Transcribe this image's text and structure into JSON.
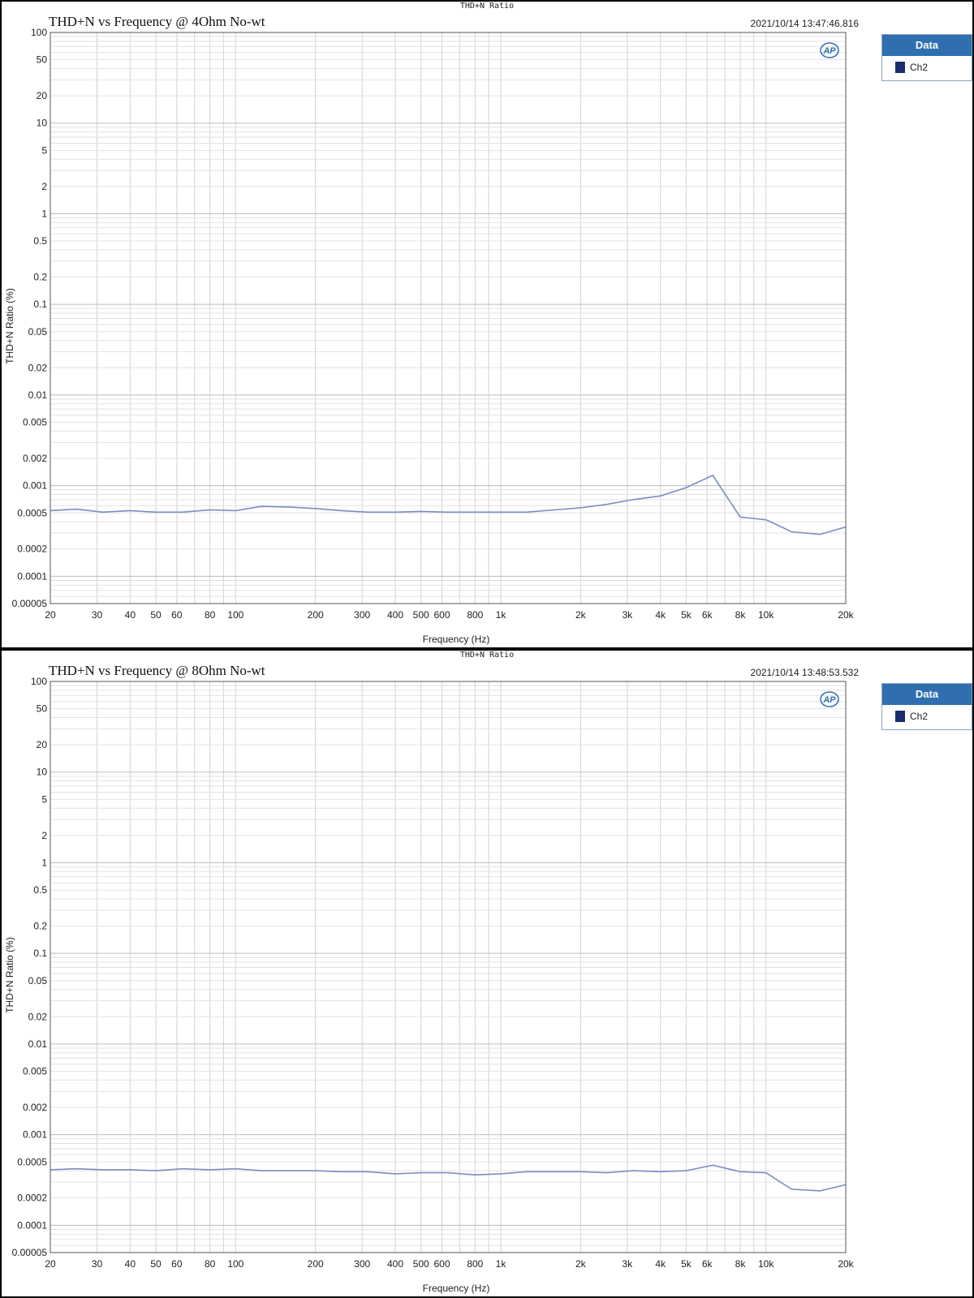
{
  "panels": [
    {
      "window_caption": "THD+N Ratio",
      "title": "THD+N vs Frequency @ 4Ohm No-wt",
      "timestamp": "2021/10/14 13:47:46.816",
      "legend": {
        "header": "Data",
        "entries": [
          "Ch2"
        ]
      },
      "logo_text": "AP",
      "colors": {
        "line": "#7b8cc4",
        "legend_header": "#2f6fb0",
        "swatch": "#1a2e6e"
      }
    },
    {
      "window_caption": "THD+N Ratio",
      "title": "THD+N vs Frequency @ 8Ohm No-wt",
      "timestamp": "2021/10/14 13:48:53.532",
      "legend": {
        "header": "Data",
        "entries": [
          "Ch2"
        ]
      },
      "logo_text": "AP",
      "colors": {
        "line": "#7b8cc4",
        "legend_header": "#2f6fb0",
        "swatch": "#1a2e6e"
      }
    }
  ],
  "chart_data": [
    {
      "type": "line",
      "title": "THD+N vs Frequency @ 4Ohm No-wt",
      "xlabel": "Frequency (Hz)",
      "ylabel": "THD+N Ratio (%)",
      "x_scale": "log",
      "y_scale": "log",
      "xlim": [
        20,
        20000
      ],
      "ylim": [
        5e-05,
        100
      ],
      "grid": true,
      "legend_placement": "right",
      "x_ticks": [
        "20",
        "30",
        "40",
        "50",
        "60",
        "80",
        "100",
        "200",
        "300",
        "400",
        "500",
        "600",
        "800",
        "1k",
        "2k",
        "3k",
        "4k",
        "5k",
        "6k",
        "8k",
        "10k",
        "20k"
      ],
      "y_ticks": [
        "100",
        "50",
        "20",
        "10",
        "5",
        "2",
        "1",
        "0.5",
        "0.2",
        "0.1",
        "0.05",
        "0.02",
        "0.01",
        "0.005",
        "0.002",
        "0.001",
        "0.0005",
        "0.0002",
        "0.0001",
        "0.00005"
      ],
      "series": [
        {
          "name": "Ch2",
          "x": [
            20,
            25,
            31.5,
            40,
            50,
            63,
            80,
            100,
            125,
            160,
            200,
            250,
            315,
            400,
            500,
            630,
            800,
            1000,
            1250,
            1600,
            2000,
            2500,
            3150,
            4000,
            5000,
            6300,
            8000,
            10000,
            12500,
            16000,
            20000
          ],
          "y": [
            0.00053,
            0.00055,
            0.00051,
            0.00053,
            0.00051,
            0.00051,
            0.00054,
            0.00053,
            0.00059,
            0.00058,
            0.00056,
            0.00053,
            0.00051,
            0.00051,
            0.00052,
            0.00051,
            0.00051,
            0.00051,
            0.00051,
            0.00054,
            0.00057,
            0.00062,
            0.0007,
            0.00077,
            0.00095,
            0.0013,
            0.00045,
            0.00042,
            0.00031,
            0.00029,
            0.00035
          ]
        }
      ]
    },
    {
      "type": "line",
      "title": "THD+N vs Frequency @ 8Ohm No-wt",
      "xlabel": "Frequency (Hz)",
      "ylabel": "THD+N Ratio (%)",
      "x_scale": "log",
      "y_scale": "log",
      "xlim": [
        20,
        20000
      ],
      "ylim": [
        5e-05,
        100
      ],
      "grid": true,
      "legend_placement": "right",
      "x_ticks": [
        "20",
        "30",
        "40",
        "50",
        "60",
        "80",
        "100",
        "200",
        "300",
        "400",
        "500",
        "600",
        "800",
        "1k",
        "2k",
        "3k",
        "4k",
        "5k",
        "6k",
        "8k",
        "10k",
        "20k"
      ],
      "y_ticks": [
        "100",
        "50",
        "20",
        "10",
        "5",
        "2",
        "1",
        "0.5",
        "0.2",
        "0.1",
        "0.05",
        "0.02",
        "0.01",
        "0.005",
        "0.002",
        "0.001",
        "0.0005",
        "0.0002",
        "0.0001",
        "0.00005"
      ],
      "series": [
        {
          "name": "Ch2",
          "x": [
            20,
            25,
            31.5,
            40,
            50,
            63,
            80,
            100,
            125,
            160,
            200,
            250,
            315,
            400,
            500,
            630,
            800,
            1000,
            1250,
            1600,
            2000,
            2500,
            3150,
            4000,
            5000,
            6300,
            8000,
            10000,
            12500,
            16000,
            20000
          ],
          "y": [
            0.00041,
            0.00042,
            0.00041,
            0.00041,
            0.0004,
            0.00042,
            0.00041,
            0.00042,
            0.0004,
            0.0004,
            0.0004,
            0.00039,
            0.00039,
            0.00037,
            0.00038,
            0.00038,
            0.00036,
            0.00037,
            0.00039,
            0.00039,
            0.00039,
            0.00038,
            0.0004,
            0.00039,
            0.0004,
            0.00046,
            0.00039,
            0.00038,
            0.00025,
            0.00024,
            0.00028
          ]
        }
      ]
    }
  ]
}
